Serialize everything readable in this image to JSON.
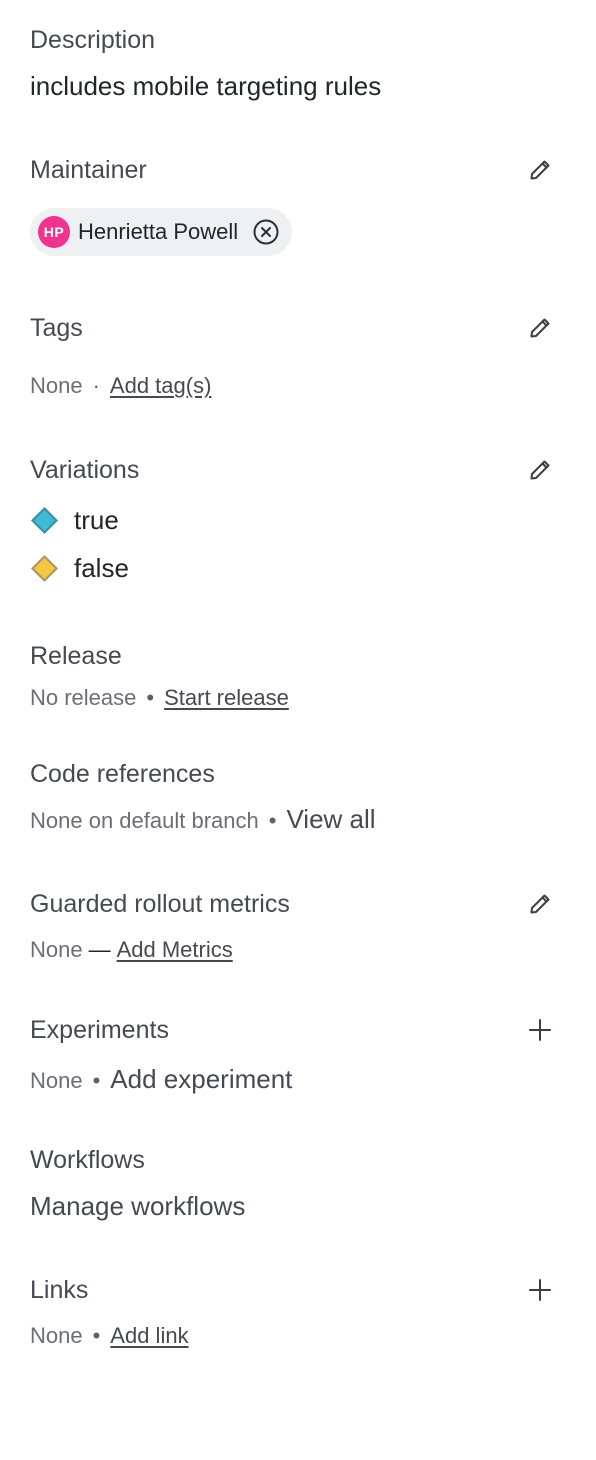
{
  "description": {
    "heading": "Description",
    "text": "includes mobile targeting rules"
  },
  "maintainer": {
    "heading": "Maintainer",
    "edit_icon": "pencil-icon",
    "chip": {
      "initials": "HP",
      "name": "Henrietta Powell",
      "remove_icon": "circle-x-icon",
      "avatar_color": "#f0338f"
    }
  },
  "tags": {
    "heading": "Tags",
    "edit_icon": "pencil-icon",
    "none_text": "None",
    "separator": "·",
    "add_link": "Add tag(s)"
  },
  "variations": {
    "heading": "Variations",
    "edit_icon": "pencil-icon",
    "items": [
      {
        "label": "true",
        "color": "#3dbad6"
      },
      {
        "label": "false",
        "color": "#f2c744"
      }
    ]
  },
  "release": {
    "heading": "Release",
    "status": "No release",
    "separator": "•",
    "action": "Start release"
  },
  "code_references": {
    "heading": "Code references",
    "status": "None on default branch",
    "separator": "•",
    "action": "View all"
  },
  "guarded_rollout_metrics": {
    "heading": "Guarded rollout metrics",
    "edit_icon": "pencil-icon",
    "status": "None",
    "separator": "—",
    "action": "Add Metrics"
  },
  "experiments": {
    "heading": "Experiments",
    "add_icon": "plus-icon",
    "status": "None",
    "separator": "•",
    "action": "Add experiment"
  },
  "workflows": {
    "heading": "Workflows",
    "action": "Manage workflows"
  },
  "links": {
    "heading": "Links",
    "add_icon": "plus-icon",
    "status": "None",
    "separator": "•",
    "action": "Add link"
  }
}
